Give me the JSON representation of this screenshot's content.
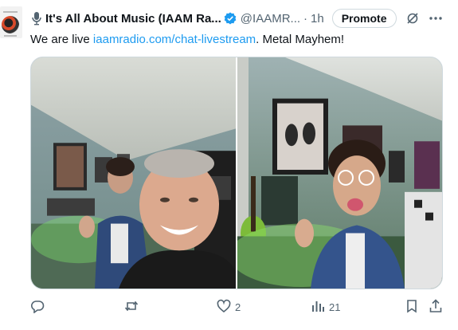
{
  "author": {
    "name": "It's All About Music (IAAM Ra...",
    "handle": "@IAAMR...",
    "separator": "·",
    "time": "1h",
    "avatar_icon": "iaam-logo",
    "name_prefix_icon": "microphone-icon",
    "verified_color": "#1d9bf0"
  },
  "header": {
    "promote_label": "Promote",
    "grok_icon": "grok-icon",
    "more_icon": "more-icon"
  },
  "tweet": {
    "text_before": "We are live ",
    "link": "iaamradio.com/chat-livestream",
    "text_after": ". Metal Mayhem!",
    "link_color": "#1d9bf0"
  },
  "media": {
    "photos": [
      "selfie-with-guest-in-studio",
      "guest-tongue-out-rock-hand"
    ]
  },
  "actions": {
    "reply_icon": "reply-icon",
    "repost_icon": "repost-icon",
    "like_icon": "heart-icon",
    "like_count": "2",
    "views_icon": "views-icon",
    "views_count": "21",
    "bookmark_icon": "bookmark-icon",
    "share_icon": "share-icon"
  }
}
